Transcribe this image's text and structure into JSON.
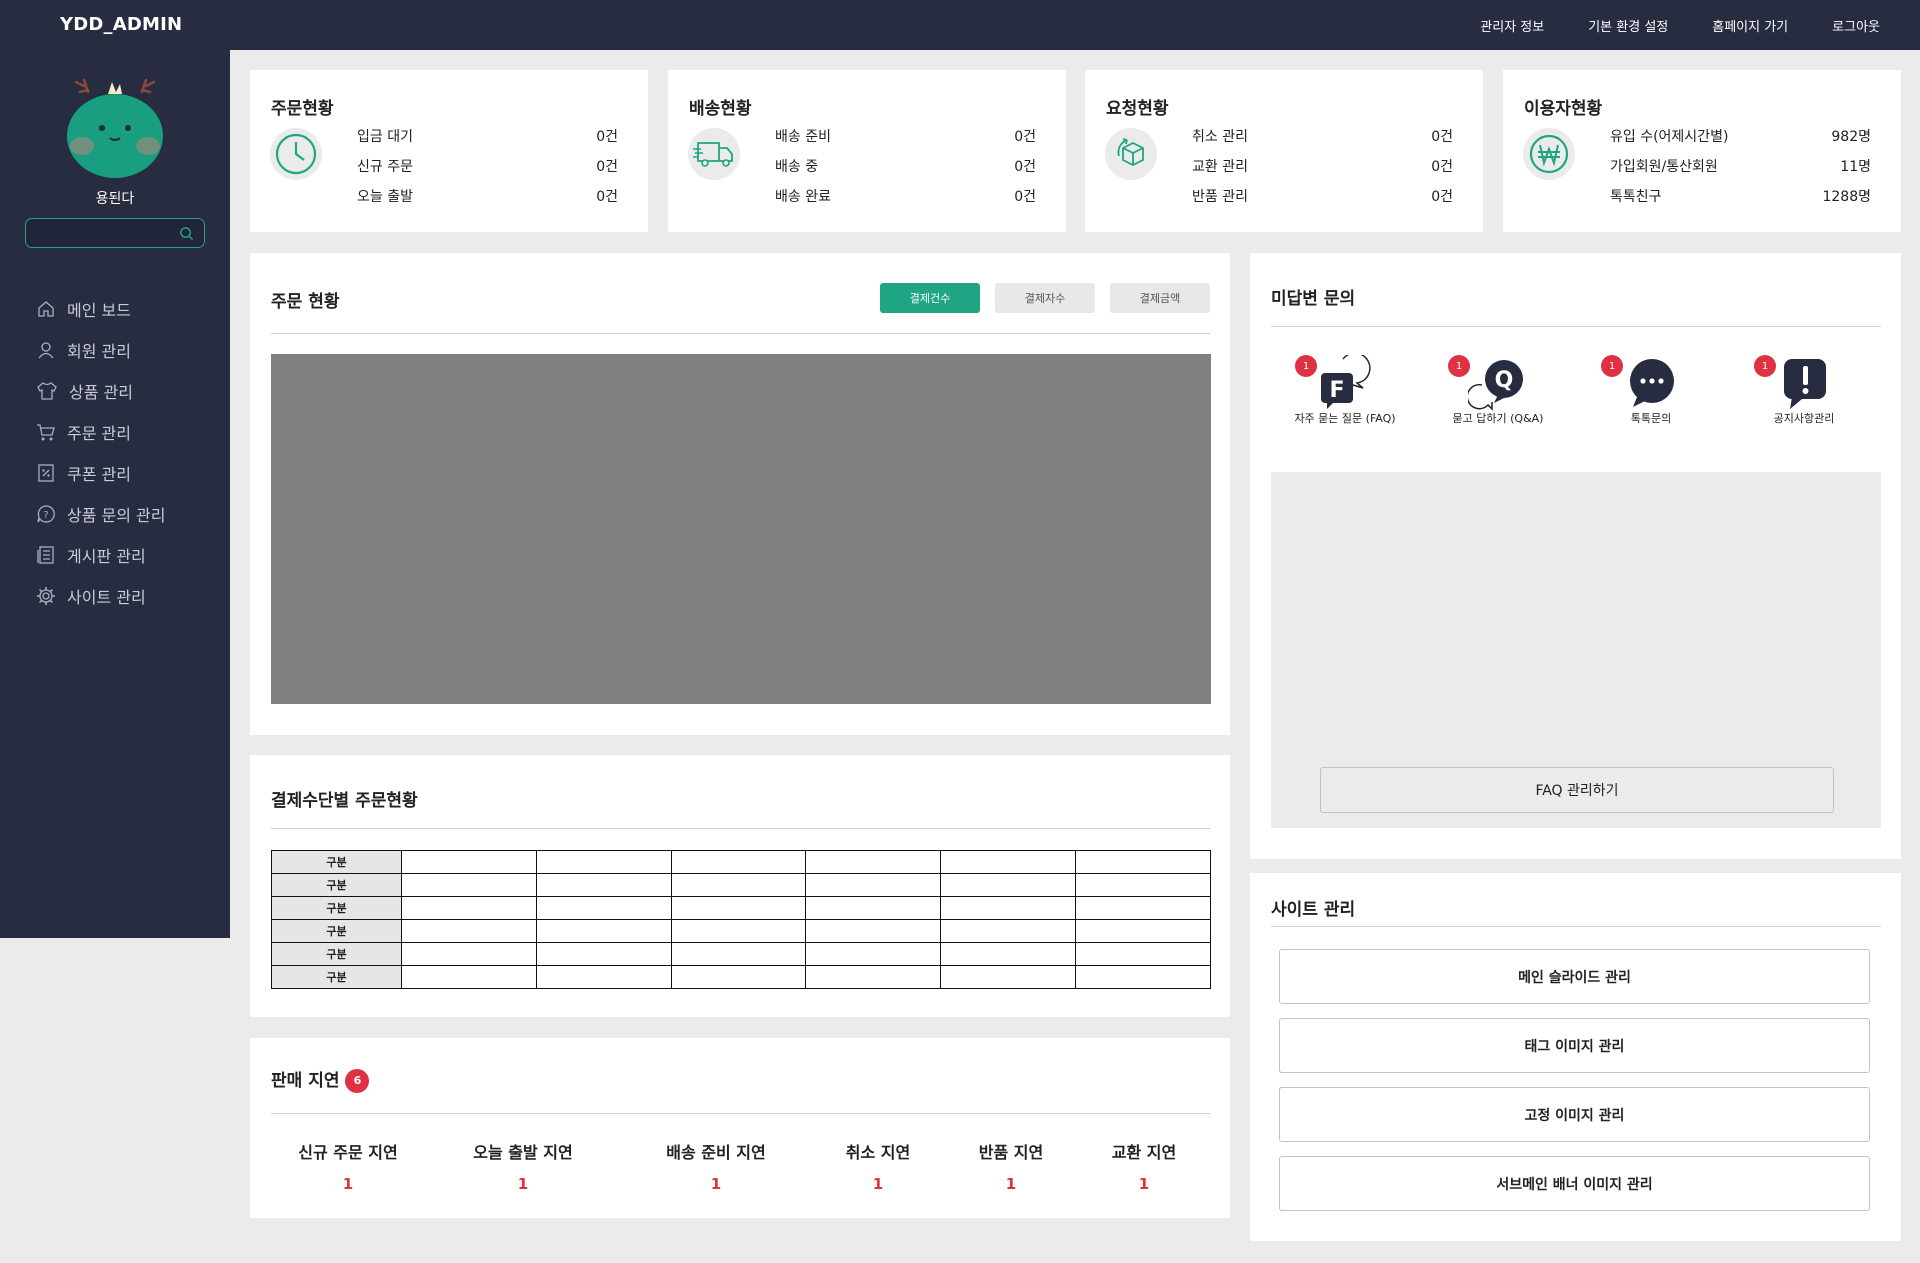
{
  "header": {
    "brand": "YDD_ADMIN",
    "nav": [
      "관리자 정보",
      "기본 환경 설정",
      "홈페이지 가기",
      "로그아웃"
    ]
  },
  "sidebar": {
    "nickname": "용된다",
    "search_value": "",
    "items": [
      {
        "label": "메인 보드",
        "icon": "home-icon"
      },
      {
        "label": "회원 관리",
        "icon": "user-icon"
      },
      {
        "label": "상품 관리",
        "icon": "shirt-icon"
      },
      {
        "label": "주문 관리",
        "icon": "cart-icon"
      },
      {
        "label": "쿠폰 관리",
        "icon": "coupon-icon"
      },
      {
        "label": "상품 문의 관리",
        "icon": "question-icon"
      },
      {
        "label": "게시판 관리",
        "icon": "board-icon"
      },
      {
        "label": "사이트 관리",
        "icon": "gear-icon"
      }
    ]
  },
  "stats": [
    {
      "title": "주문현황",
      "icon": "clock-icon",
      "rows": [
        {
          "label": "입금 대기",
          "value": "0건"
        },
        {
          "label": "신규 주문",
          "value": "0건"
        },
        {
          "label": "오늘 출발",
          "value": "0건"
        }
      ]
    },
    {
      "title": "배송현황",
      "icon": "truck-icon",
      "rows": [
        {
          "label": "배송 준비",
          "value": "0건"
        },
        {
          "label": "배송 중",
          "value": "0건"
        },
        {
          "label": "배송 완료",
          "value": "0건"
        }
      ]
    },
    {
      "title": "요청현황",
      "icon": "box-return-icon",
      "rows": [
        {
          "label": "취소 관리",
          "value": "0건"
        },
        {
          "label": "교환 관리",
          "value": "0건"
        },
        {
          "label": "반품 관리",
          "value": "0건"
        }
      ]
    },
    {
      "title": "이용자현황",
      "icon": "won-icon",
      "rows": [
        {
          "label": "유입 수(어제시간별)",
          "value": "982명"
        },
        {
          "label": "가입회원/통산회원",
          "value": "11명"
        },
        {
          "label": "톡톡친구",
          "value": "1288명"
        }
      ]
    }
  ],
  "orders_panel": {
    "title": "주문 현황",
    "tabs": [
      "결제건수",
      "결제자수",
      "결제금액"
    ]
  },
  "payment_panel": {
    "title": "결제수단별 주문현황",
    "row_header": "구분"
  },
  "delay_panel": {
    "title": "판매 지연",
    "badge": "6",
    "items": [
      {
        "label": "신규 주문 지연",
        "value": "1"
      },
      {
        "label": "오늘 출발 지연",
        "value": "1"
      },
      {
        "label": "배송 준비 지연",
        "value": "1"
      },
      {
        "label": "취소 지연",
        "value": "1"
      },
      {
        "label": "반품 지연",
        "value": "1"
      },
      {
        "label": "교환 지연",
        "value": "1"
      }
    ]
  },
  "inquiry_panel": {
    "title": "미답변 문의",
    "items": [
      {
        "label": "자주 묻는 질문 (FAQ)",
        "badge": "1",
        "glyph": "F"
      },
      {
        "label": "묻고 답하기 (Q&A)",
        "badge": "1",
        "glyph": "Q"
      },
      {
        "label": "톡톡문의",
        "badge": "1",
        "glyph": "···"
      },
      {
        "label": "공지사항관리",
        "badge": "1",
        "glyph": "!"
      }
    ],
    "manage_button": "FAQ 관리하기"
  },
  "site_panel": {
    "title": "사이트 관리",
    "buttons": [
      "메인 슬라이드 관리",
      "태그 이미지 관리",
      "고정 이미지 관리",
      "서브메인 배너 이미지 관리"
    ]
  },
  "colors": {
    "accent": "#1fa584",
    "sidebar": "#272c40",
    "badge": "#e03142"
  }
}
